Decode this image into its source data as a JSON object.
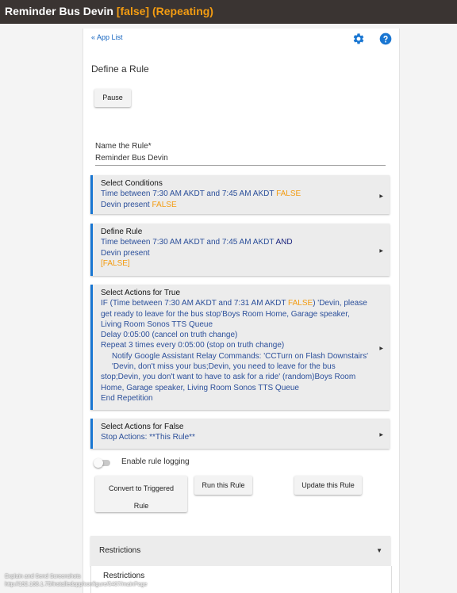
{
  "header": {
    "title": "Reminder Bus Devin",
    "status": "[false]",
    "mode": "(Repeating)"
  },
  "nav": {
    "back_link": "« App List"
  },
  "icons": {
    "settings": "gear-icon",
    "help": "help-icon"
  },
  "page": {
    "heading": "Define a Rule"
  },
  "buttons": {
    "pause": "Pause",
    "convert_line1": "Convert to Triggered",
    "convert_line2": "Rule",
    "run": "Run this Rule",
    "update": "Update this Rule"
  },
  "name_field": {
    "label": "Name the Rule*",
    "value": "Reminder Bus Devin"
  },
  "conditions": {
    "title": "Select Conditions",
    "line1": "Time between 7:30 AM AKDT and 7:45 AM AKDT",
    "line1_state": "FALSE",
    "line2": "Devin present",
    "line2_state": "FALSE"
  },
  "define_rule": {
    "title": "Define Rule",
    "line1": "Time between 7:30 AM AKDT and 7:45 AM AKDT",
    "operator": "AND",
    "line2": "Devin present",
    "result": "[FALSE]"
  },
  "actions_true": {
    "title": "Select Actions for True",
    "if_prefix": "IF (Time between 7:30 AM AKDT and 7:31 AM AKDT",
    "if_state": "FALSE",
    "if_rest_line1": ") 'Devin, please",
    "line2": "get ready to leave for the bus stop'Boys Room Home, Garage speaker,",
    "line3": "Living Room Sonos TTS Queue",
    "line4": "Delay 0:05:00 (cancel on truth change)",
    "line5": "Repeat 3 times every 0:05:00 (stop on truth change)",
    "line6": "Notify Google Assistant Relay Commands: 'CCTurn on Flash Downstairs'",
    "line7": "'Devin, don't miss your bus;Devin, you need to leave for the bus",
    "line8": "stop;Devin, you don't want to have to ask for a ride' (random)Boys Room",
    "line9": "Home, Garage speaker, Living Room Sonos TTS Queue",
    "line10": "End Repetition"
  },
  "actions_false": {
    "title": "Select Actions for False",
    "line1": "Stop Actions: **This Rule**"
  },
  "logging": {
    "label": "Enable rule logging"
  },
  "restrictions": {
    "header": "Restrictions",
    "sub": "Restrictions"
  },
  "overlay": {
    "line1": "Explain and Send Screenshots",
    "line2": "http://192.168.1.75/installedapp/configure/5407/mainPage"
  },
  "colors": {
    "accent_blue": "#1976d2",
    "false_orange": "#f39c12",
    "topbar": "#3a3432"
  }
}
